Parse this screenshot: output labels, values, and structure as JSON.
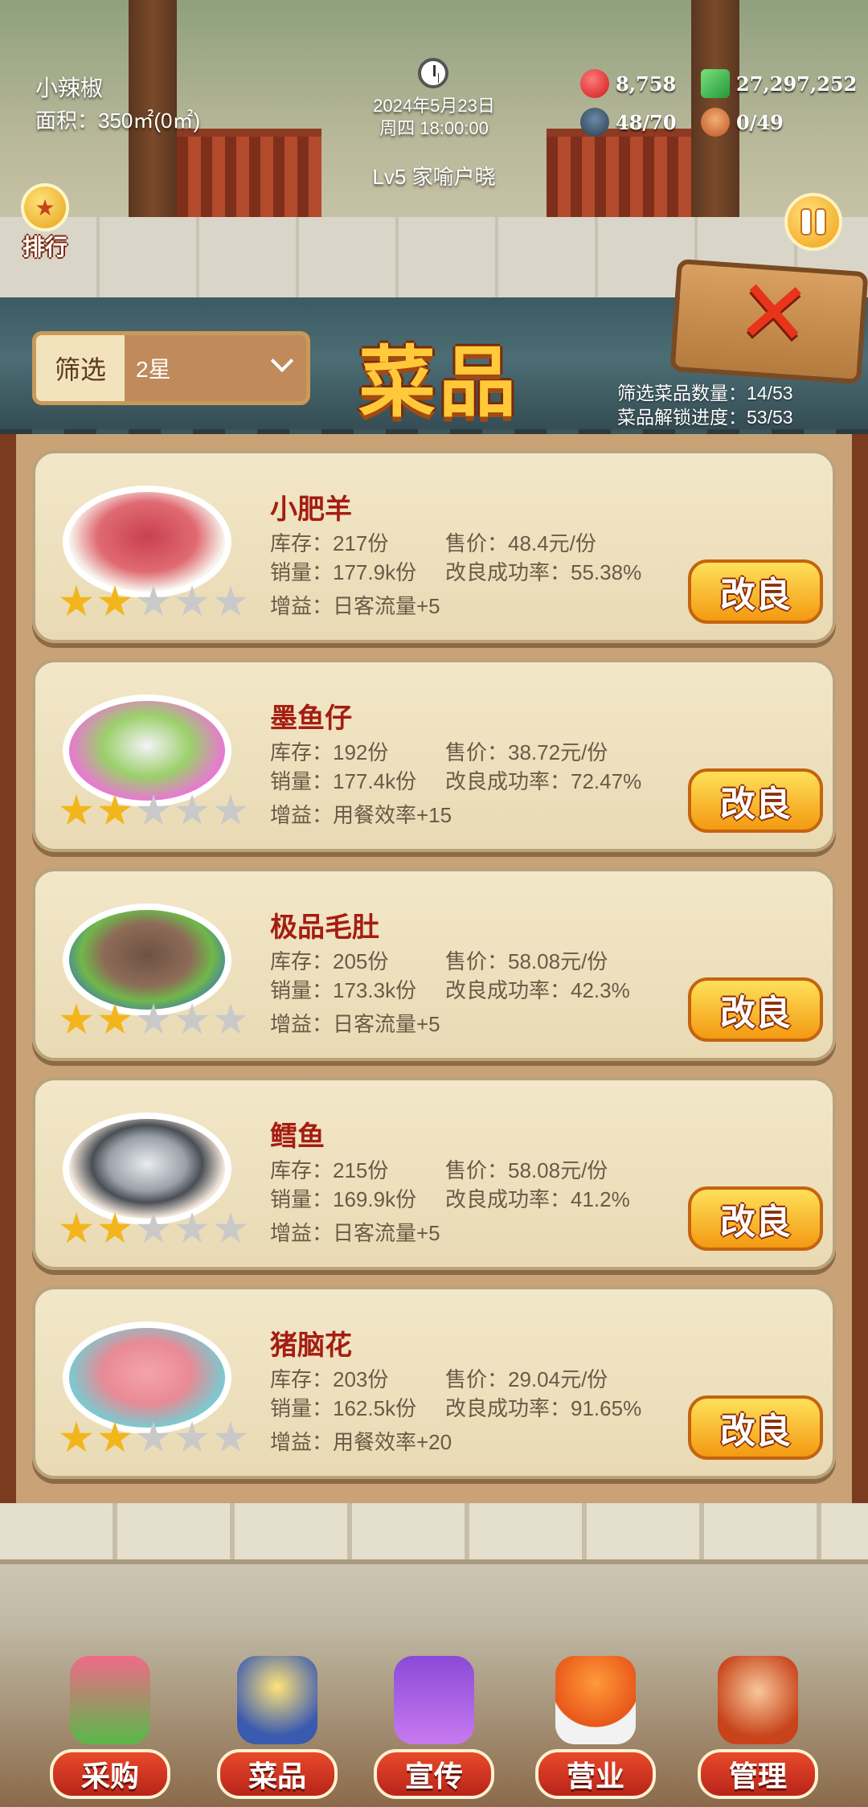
{
  "hud": {
    "shop_name": "小辣椒",
    "area": "面积：350㎡(0㎡)",
    "date": "2024年5月23日",
    "weekday_time": "周四 18:00:00",
    "level": "Lv5 家喻户晓",
    "hearts": "8,758",
    "cash": "27,297,252",
    "staff": "48/70",
    "guests": "0/49",
    "rank_label": "排行"
  },
  "panel": {
    "title": "菜品",
    "filter_label": "筛选",
    "filter_value": "2星",
    "filtered_count": "筛选菜品数量：14/53",
    "unlock_progress": "菜品解锁进度：53/53",
    "improve_label": "改良"
  },
  "dishes": [
    {
      "name": "小肥羊",
      "stock": "库存：217份",
      "price": "售价：48.4元/份",
      "sales": "销量：177.9k份",
      "rate": "改良成功率：55.38%",
      "bonus": "增益：日客流量+5",
      "stars": 2
    },
    {
      "name": "墨鱼仔",
      "stock": "库存：192份",
      "price": "售价：38.72元/份",
      "sales": "销量：177.4k份",
      "rate": "改良成功率：72.47%",
      "bonus": "增益：用餐效率+15",
      "stars": 2
    },
    {
      "name": "极品毛肚",
      "stock": "库存：205份",
      "price": "售价：58.08元/份",
      "sales": "销量：173.3k份",
      "rate": "改良成功率：42.3%",
      "bonus": "增益：日客流量+5",
      "stars": 2
    },
    {
      "name": "鳕鱼",
      "stock": "库存：215份",
      "price": "售价：58.08元/份",
      "sales": "销量：169.9k份",
      "rate": "改良成功率：41.2%",
      "bonus": "增益：日客流量+5",
      "stars": 2
    },
    {
      "name": "猪脑花",
      "stock": "库存：203份",
      "price": "售价：29.04元/份",
      "sales": "销量：162.5k份",
      "rate": "改良成功率：91.65%",
      "bonus": "增益：用餐效率+20",
      "stars": 2
    }
  ],
  "nav": [
    {
      "label": "采购",
      "icon": "market-stall-icon"
    },
    {
      "label": "菜品",
      "icon": "dish-bowl-icon"
    },
    {
      "label": "宣传",
      "icon": "clapperboard-icon"
    },
    {
      "label": "营业",
      "icon": "waiter-cloche-icon"
    },
    {
      "label": "管理",
      "icon": "staff-manage-icon"
    }
  ]
}
